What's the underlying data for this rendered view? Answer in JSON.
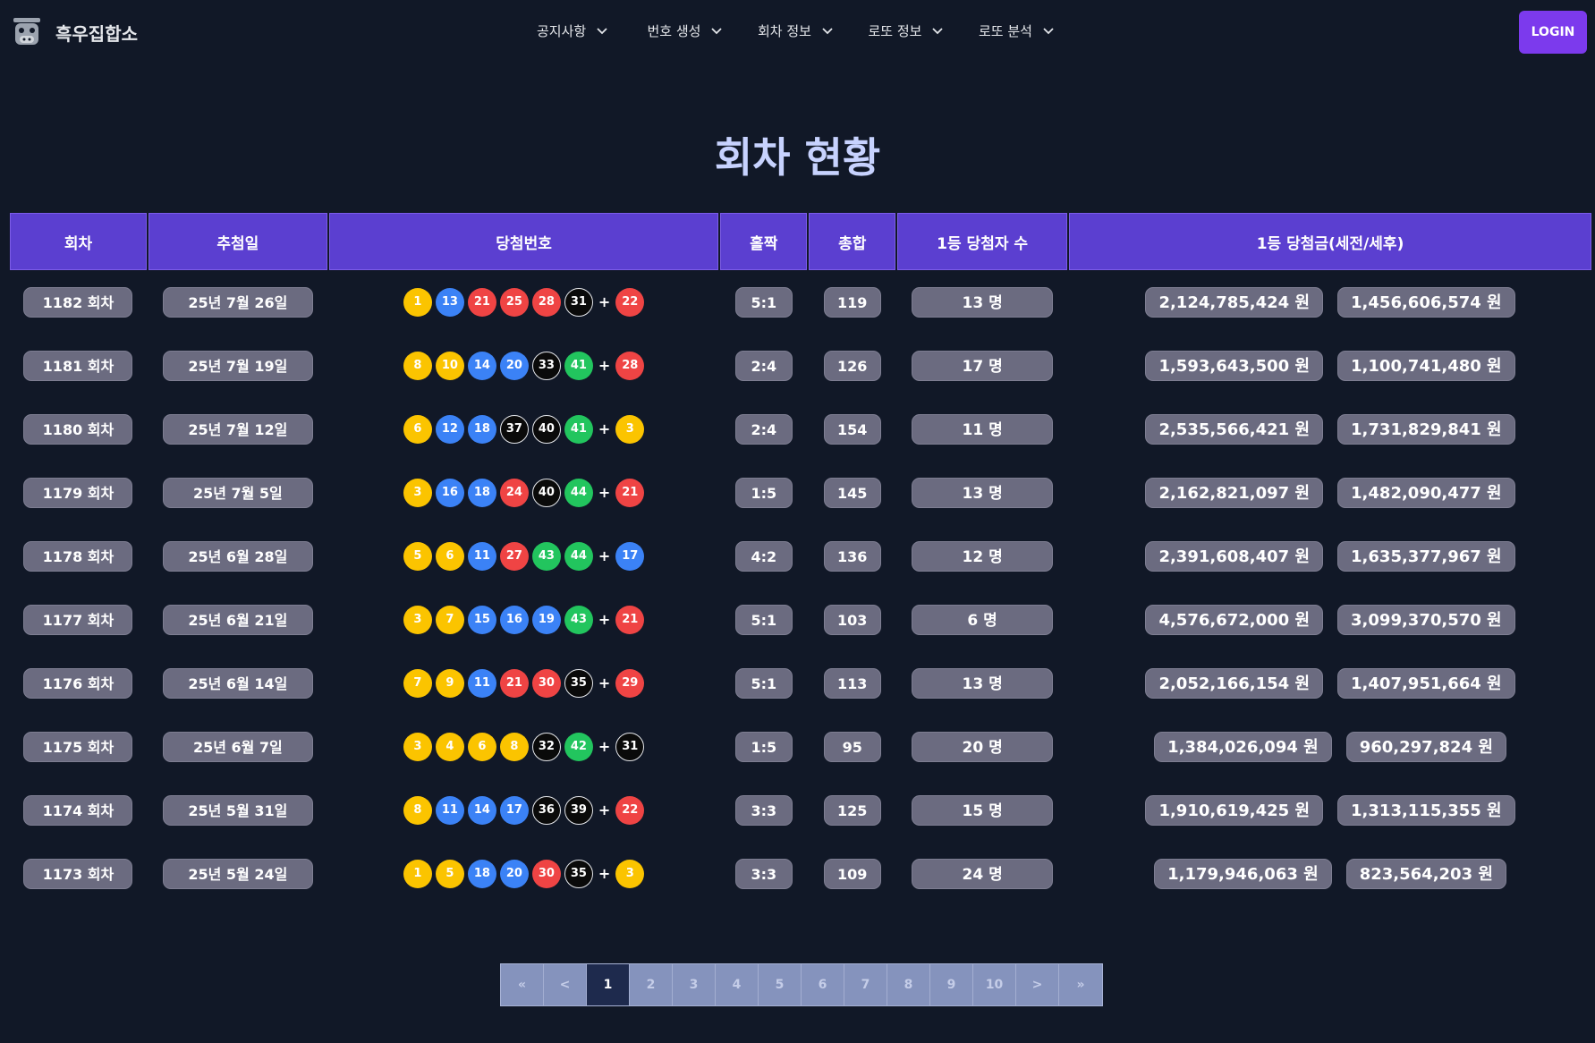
{
  "brand": {
    "name": "흑우집합소",
    "logo_icon": "cow-icon"
  },
  "nav": {
    "items": [
      {
        "label": "공지사항"
      },
      {
        "label": "번호 생성"
      },
      {
        "label": "회차 정보"
      },
      {
        "label": "로또 정보"
      },
      {
        "label": "로또 분석"
      }
    ],
    "login_label": "LOGIN"
  },
  "page": {
    "title": "회차 현황"
  },
  "table": {
    "headers": [
      "회차",
      "추첨일",
      "당첨번호",
      "홀짝",
      "총합",
      "1등 당첨자 수",
      "1등 당첨금(세전/세후)"
    ],
    "rows": [
      {
        "round": "1182 회차",
        "date": "25년 7월 26일",
        "numbers": [
          1,
          13,
          21,
          25,
          28,
          31
        ],
        "bonus": 22,
        "odd_even": "5:1",
        "sum": "119",
        "winners": "13 명",
        "prize_pre": "2,124,785,424 원",
        "prize_post": "1,456,606,574 원"
      },
      {
        "round": "1181 회차",
        "date": "25년 7월 19일",
        "numbers": [
          8,
          10,
          14,
          20,
          33,
          41
        ],
        "bonus": 28,
        "odd_even": "2:4",
        "sum": "126",
        "winners": "17 명",
        "prize_pre": "1,593,643,500 원",
        "prize_post": "1,100,741,480 원"
      },
      {
        "round": "1180 회차",
        "date": "25년 7월 12일",
        "numbers": [
          6,
          12,
          18,
          37,
          40,
          41
        ],
        "bonus": 3,
        "odd_even": "2:4",
        "sum": "154",
        "winners": "11 명",
        "prize_pre": "2,535,566,421 원",
        "prize_post": "1,731,829,841 원"
      },
      {
        "round": "1179 회차",
        "date": "25년 7월 5일",
        "numbers": [
          3,
          16,
          18,
          24,
          40,
          44
        ],
        "bonus": 21,
        "odd_even": "1:5",
        "sum": "145",
        "winners": "13 명",
        "prize_pre": "2,162,821,097 원",
        "prize_post": "1,482,090,477 원"
      },
      {
        "round": "1178 회차",
        "date": "25년 6월 28일",
        "numbers": [
          5,
          6,
          11,
          27,
          43,
          44
        ],
        "bonus": 17,
        "odd_even": "4:2",
        "sum": "136",
        "winners": "12 명",
        "prize_pre": "2,391,608,407 원",
        "prize_post": "1,635,377,967 원"
      },
      {
        "round": "1177 회차",
        "date": "25년 6월 21일",
        "numbers": [
          3,
          7,
          15,
          16,
          19,
          43
        ],
        "bonus": 21,
        "odd_even": "5:1",
        "sum": "103",
        "winners": "6 명",
        "prize_pre": "4,576,672,000 원",
        "prize_post": "3,099,370,570 원"
      },
      {
        "round": "1176 회차",
        "date": "25년 6월 14일",
        "numbers": [
          7,
          9,
          11,
          21,
          30,
          35
        ],
        "bonus": 29,
        "odd_even": "5:1",
        "sum": "113",
        "winners": "13 명",
        "prize_pre": "2,052,166,154 원",
        "prize_post": "1,407,951,664 원"
      },
      {
        "round": "1175 회차",
        "date": "25년 6월 7일",
        "numbers": [
          3,
          4,
          6,
          8,
          32,
          42
        ],
        "bonus": 31,
        "odd_even": "1:5",
        "sum": "95",
        "winners": "20 명",
        "prize_pre": "1,384,026,094 원",
        "prize_post": "960,297,824 원"
      },
      {
        "round": "1174 회차",
        "date": "25년 5월 31일",
        "numbers": [
          8,
          11,
          14,
          17,
          36,
          39
        ],
        "bonus": 22,
        "odd_even": "3:3",
        "sum": "125",
        "winners": "15 명",
        "prize_pre": "1,910,619,425 원",
        "prize_post": "1,313,115,355 원"
      },
      {
        "round": "1173 회차",
        "date": "25년 5월 24일",
        "numbers": [
          1,
          5,
          18,
          20,
          30,
          35
        ],
        "bonus": 3,
        "odd_even": "3:3",
        "sum": "109",
        "winners": "24 명",
        "prize_pre": "1,179,946,063 원",
        "prize_post": "823,564,203 원"
      }
    ]
  },
  "ball_colors": {
    "yellow": "#fbc400",
    "blue": "#3b82f6",
    "red": "#ef4444",
    "black": "#0a0a0a",
    "green": "#22c55e"
  },
  "pagination": {
    "first": "«",
    "prev": "<",
    "next": ">",
    "last": "»",
    "pages": [
      "1",
      "2",
      "3",
      "4",
      "5",
      "6",
      "7",
      "8",
      "9",
      "10"
    ],
    "current": "1"
  }
}
